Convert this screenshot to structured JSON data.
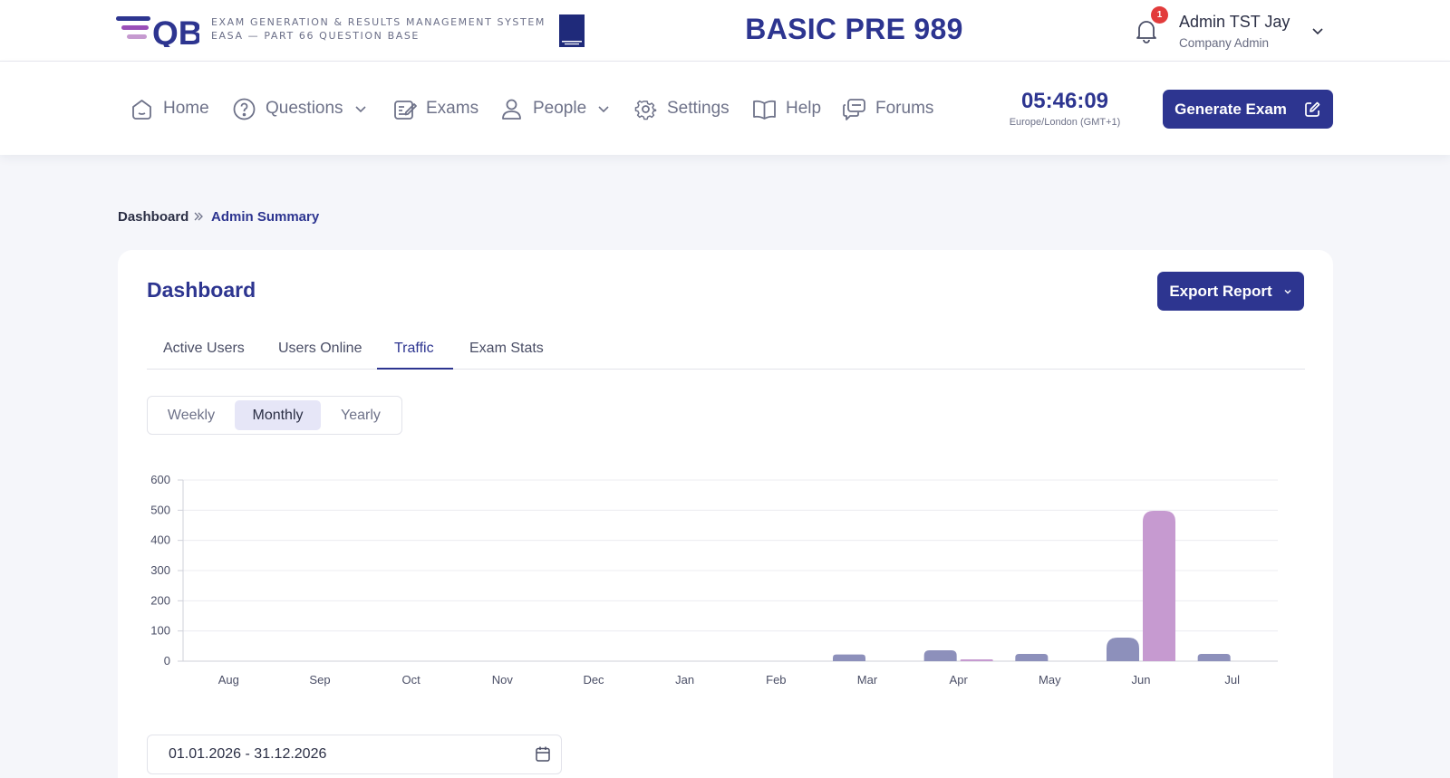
{
  "header": {
    "logo_text_line1": "EXAM GENERATION & RESULTS MANAGEMENT SYSTEM",
    "logo_text_line2": "EASA — PART 66 QUESTION BASE",
    "app_title": "BASIC PRE 989",
    "notification_count": "1",
    "user_name": "Admin TST Jay",
    "user_role": "Company Admin"
  },
  "nav": {
    "items": [
      {
        "label": "Home",
        "icon": "home-icon"
      },
      {
        "label": "Questions",
        "icon": "question-circle-icon",
        "has_dropdown": true
      },
      {
        "label": "Exams",
        "icon": "exam-edit-icon"
      },
      {
        "label": "People",
        "icon": "person-icon",
        "has_dropdown": true
      },
      {
        "label": "Settings",
        "icon": "gear-icon"
      },
      {
        "label": "Help",
        "icon": "book-icon"
      },
      {
        "label": "Forums",
        "icon": "chat-bubbles-icon"
      }
    ],
    "clock": "05:46:09",
    "timezone": "Europe/London (GMT+1)",
    "generate_exam_label": "Generate Exam"
  },
  "breadcrumb": {
    "items": [
      "Dashboard",
      "Admin Summary"
    ]
  },
  "dashboard": {
    "title": "Dashboard",
    "export_label": "Export Report",
    "tabs": [
      "Active Users",
      "Users Online",
      "Traffic",
      "Exam Stats"
    ],
    "active_tab": "Traffic",
    "periods": [
      "Weekly",
      "Monthly",
      "Yearly"
    ],
    "active_period": "Monthly",
    "date_range": "01.01.2026 - 31.12.2026"
  },
  "colors": {
    "brand": "#2d3590",
    "series_a": "#8d90bb",
    "series_b": "#c69ad0",
    "badge": "#e23b3b"
  },
  "chart_data": {
    "type": "bar",
    "categories": [
      "Aug",
      "Sep",
      "Oct",
      "Nov",
      "Dec",
      "Jan",
      "Feb",
      "Mar",
      "Apr",
      "May",
      "Jun",
      "Jul"
    ],
    "series": [
      {
        "values": [
          0,
          0,
          0,
          0,
          0,
          0,
          0,
          22,
          36,
          24,
          78,
          24
        ]
      },
      {
        "values": [
          0,
          0,
          0,
          0,
          0,
          0,
          0,
          0,
          6,
          0,
          498,
          0
        ]
      }
    ],
    "yticks": [
      0,
      100,
      200,
      300,
      400,
      500,
      600
    ],
    "ylim": [
      0,
      600
    ],
    "grid": true,
    "legend": "none"
  }
}
